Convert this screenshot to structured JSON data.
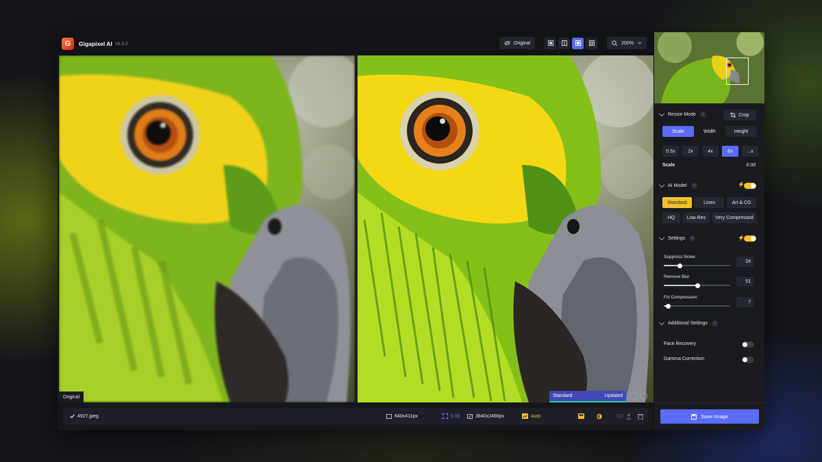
{
  "app": {
    "name": "Gigapixel AI",
    "version": "v6.3.0"
  },
  "toolbar": {
    "original_label": "Original",
    "zoom_label": "200%"
  },
  "preview": {
    "left_label": "Original",
    "status_model": "Standard",
    "status_state": "Updated"
  },
  "bottom": {
    "filename": "4927.jpeg",
    "input_size": "640x411px",
    "scale": "6.00",
    "output_size": "3840x2466px",
    "auto_label": "Auto",
    "gc_label": "GC"
  },
  "panel": {
    "resize_mode": {
      "title": "Resize Mode",
      "crop_label": "Crop",
      "modes": [
        "Scale",
        "Width",
        "Height"
      ],
      "active_mode": "Scale",
      "scales": [
        "0.5x",
        "2x",
        "4x",
        "6x",
        "...x"
      ],
      "active_scale": "6x",
      "scale_label": "Scale",
      "scale_value": "6.00"
    },
    "ai_model": {
      "title": "AI Model",
      "models_row1": [
        "Standard",
        "Lines",
        "Art & CG"
      ],
      "models_row2": [
        "HQ",
        "Low Res",
        "Very Compressed"
      ],
      "active_model": "Standard",
      "auto_enabled": true
    },
    "settings": {
      "title": "Settings",
      "auto_enabled": true,
      "sliders": [
        {
          "label": "Suppress Noise",
          "value": "24",
          "fraction": 0.24
        },
        {
          "label": "Remove Blur",
          "value": "51",
          "fraction": 0.51
        },
        {
          "label": "Fix Compression",
          "value": "7",
          "fraction": 0.07
        }
      ]
    },
    "additional": {
      "title": "Additional Settings",
      "face_recovery_label": "Face Recovery",
      "face_recovery_on": false,
      "gamma_label": "Gamma Correction",
      "gamma_on": false
    },
    "save_label": "Save Image"
  },
  "colors": {
    "accent": "#5b6cf9",
    "highlight": "#f2c12e",
    "status_ok": "#22d18b"
  }
}
